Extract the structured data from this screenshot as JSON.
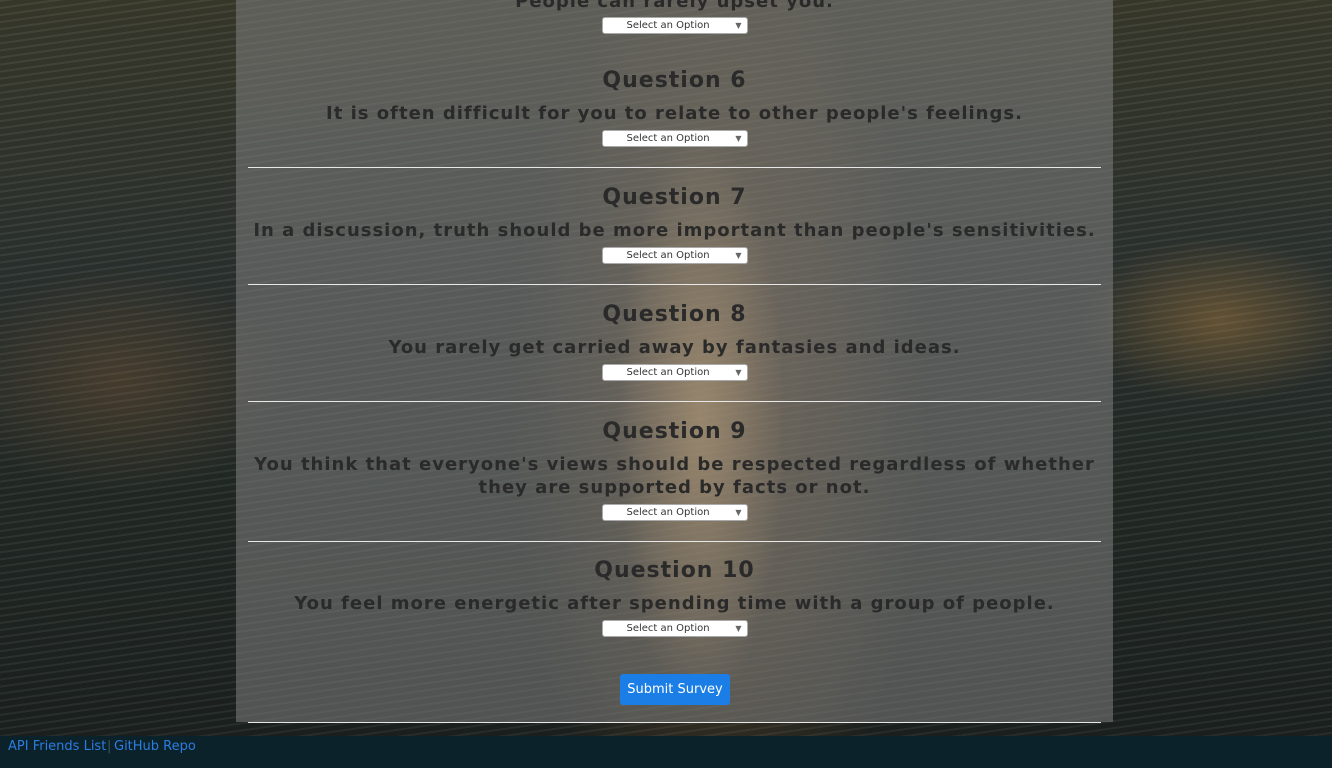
{
  "questions": [
    {
      "title": "",
      "text": "People can rarely upset you.",
      "select": "Select an Option"
    },
    {
      "title": "Question 6",
      "text": "It is often difficult for you to relate to other people's feelings.",
      "select": "Select an Option"
    },
    {
      "title": "Question 7",
      "text": "In a discussion, truth should be more important than people's sensitivities.",
      "select": "Select an Option"
    },
    {
      "title": "Question 8",
      "text": "You rarely get carried away by fantasies and ideas.",
      "select": "Select an Option"
    },
    {
      "title": "Question 9",
      "text": "You think that everyone's views should be respected regardless of whether they are supported by facts or not.",
      "select": "Select an Option"
    },
    {
      "title": "Question 10",
      "text": "You feel more energetic after spending time with a group of people.",
      "select": "Select an Option"
    }
  ],
  "submit_label": "Submit Survey",
  "footer": {
    "links": [
      "API Friends List",
      "GitHub Repo"
    ],
    "separator": "|"
  },
  "colors": {
    "accent": "#1a7ee6",
    "link": "#2b7de0",
    "footer_bg": "#0c222b"
  }
}
